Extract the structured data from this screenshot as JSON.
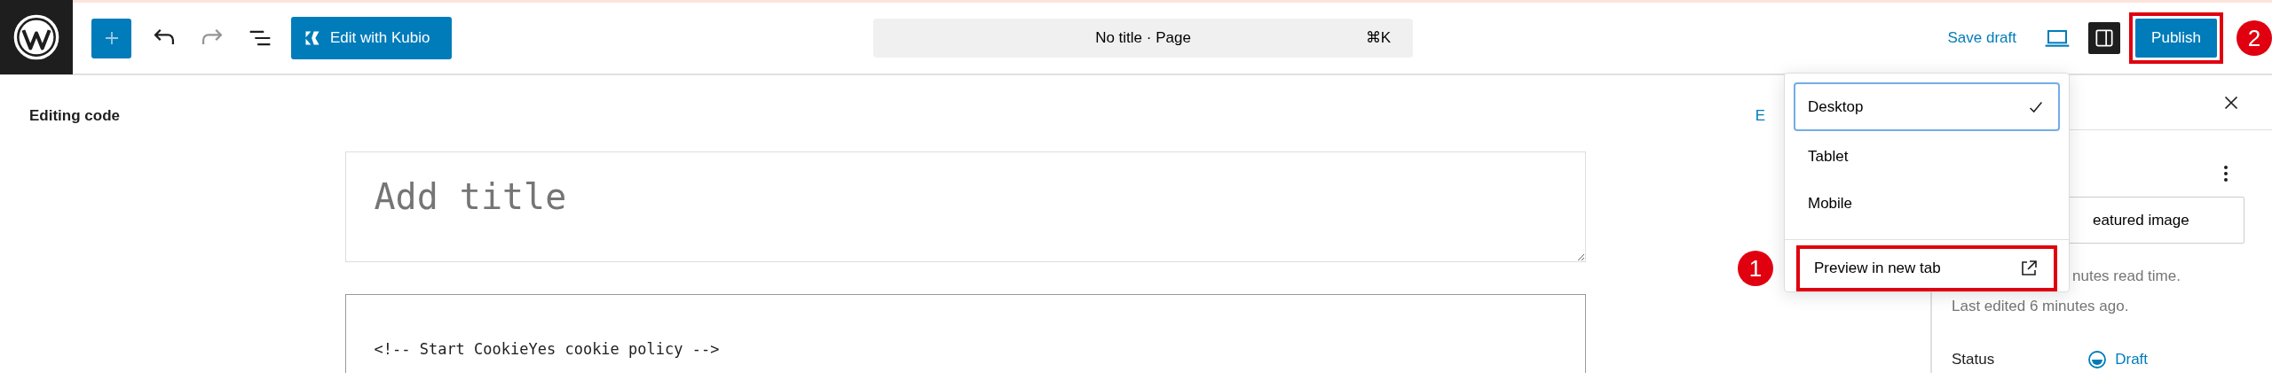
{
  "toolbar": {
    "history": [
      {
        "kind": "undo",
        "disabled": false
      },
      {
        "kind": "redo",
        "disabled": true
      }
    ],
    "kubio_button": "Edit with Kubio"
  },
  "command_bar": {
    "title": "No title · Page",
    "shortcut": "⌘K"
  },
  "actions": {
    "save_draft": "Save draft",
    "sidebar_toggle": {
      "pressed": true
    },
    "publish": {
      "label": "Publish",
      "highlighted": true,
      "badge": "2"
    }
  },
  "editor": {
    "heading": "Editing code",
    "exit_link": "E",
    "title_placeholder": "Add title",
    "code": "<!-- Start CookieYes cookie policy -->"
  },
  "preview_menu": {
    "items": [
      {
        "label": "Desktop",
        "selected": true
      },
      {
        "label": "Tablet",
        "selected": false
      },
      {
        "label": "Mobile",
        "selected": false
      }
    ],
    "new_tab": {
      "label": "Preview in new tab",
      "highlighted": true,
      "badge": "1"
    }
  },
  "sidebar": {
    "featured_image": "eatured image",
    "read_time": "nutes read time.",
    "last_edited": "Last edited 6 minutes ago.",
    "status_label": "Status",
    "status_value": "Draft"
  }
}
